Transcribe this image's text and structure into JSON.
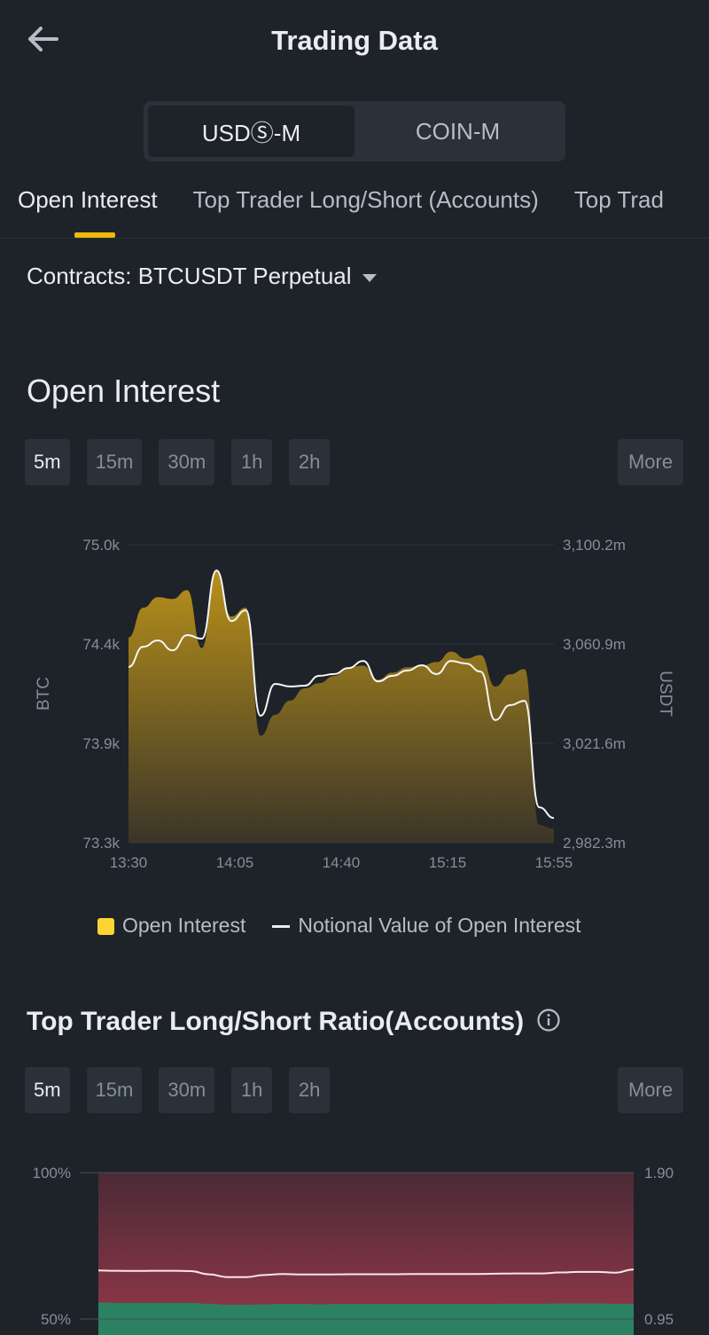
{
  "header": {
    "title": "Trading Data",
    "back_icon": "arrow-left-icon"
  },
  "segment": {
    "options": [
      "USDⓈ-M",
      "COIN-M"
    ],
    "selected": "USDⓈ-M"
  },
  "tabs": [
    "Open Interest",
    "Top Trader Long/Short (Accounts)",
    "Top Trad"
  ],
  "contract": {
    "label": "Contracts: BTCUSDT Perpetual"
  },
  "colors": {
    "accent": "#f0b90b",
    "background": "#1e2329",
    "long": "#2e8b67",
    "short": "#8f3545"
  },
  "section1": {
    "title": "Open Interest",
    "timeframes": [
      "5m",
      "15m",
      "30m",
      "1h",
      "2h"
    ],
    "selected": "5m",
    "more": "More"
  },
  "section2": {
    "title": "Top Trader Long/Short Ratio(Accounts)",
    "info_icon": "info-circle-icon",
    "timeframes": [
      "5m",
      "15m",
      "30m",
      "1h",
      "2h"
    ],
    "selected": "5m",
    "more": "More"
  },
  "chart_data": [
    {
      "type": "area",
      "ylabel": "BTC",
      "y2label": "USDT",
      "x_ticks": [
        "13:30",
        "14:05",
        "14:40",
        "15:15",
        "15:55"
      ],
      "y_ticks": [
        "75.0k",
        "74.4k",
        "73.9k",
        "73.3k"
      ],
      "y2_ticks": [
        "3,100.2m",
        "3,060.9m",
        "3,021.6m",
        "2,982.3m"
      ],
      "ylim": [
        73.3,
        75.0
      ],
      "y2lim": [
        2982.3,
        3100.2
      ],
      "interval_minutes": 5,
      "grid": "horizontal",
      "legend": {
        "placement": "bottom",
        "items": [
          "Open Interest",
          "Notional Value of Open Interest"
        ]
      },
      "series": [
        {
          "name": "Open Interest",
          "axis": "left",
          "type": "area",
          "color": "#f0b90b",
          "values": [
            74.47,
            74.64,
            74.7,
            74.69,
            74.74,
            74.41,
            74.85,
            74.59,
            74.64,
            73.91,
            74.03,
            74.11,
            74.18,
            74.21,
            74.25,
            74.3,
            74.31,
            74.23,
            74.27,
            74.3,
            74.31,
            74.33,
            74.39,
            74.35,
            74.37,
            74.19,
            74.26,
            74.29,
            73.4,
            73.38
          ]
        },
        {
          "name": "Notional Value of Open Interest",
          "axis": "right",
          "type": "line",
          "color": "#ffffff",
          "values": [
            3051.8,
            3059.8,
            3062.3,
            3058.4,
            3064.4,
            3063.0,
            3090.0,
            3070.0,
            3074.2,
            3032.5,
            3045.1,
            3044.1,
            3044.4,
            3048.3,
            3049.0,
            3051.4,
            3054.2,
            3046.1,
            3048.3,
            3050.4,
            3052.5,
            3049.0,
            3054.2,
            3053.2,
            3050.0,
            3030.8,
            3036.7,
            3038.4,
            2996.3,
            2992.1
          ]
        }
      ]
    },
    {
      "type": "area",
      "y_ticks": [
        "100%",
        "50%"
      ],
      "y2_ticks": [
        "1.90",
        "0.95"
      ],
      "ylim": [
        50,
        100
      ],
      "y2lim": [
        0.95,
        1.9
      ],
      "series": [
        {
          "axis": "left",
          "type": "stacked-area",
          "color": "#2e8b67",
          "values": [
            55.6,
            55.5,
            55.5,
            55.5,
            55.5,
            55.5,
            55.2,
            54.9,
            54.9,
            55.0,
            55.1,
            55.1,
            55.0,
            55.1,
            55.1,
            55.1,
            55.1,
            55.1,
            55.1,
            55.1,
            55.1,
            55.1,
            55.2,
            55.2,
            55.2,
            55.3,
            55.3,
            55.3,
            55.2,
            55.2
          ]
        },
        {
          "axis": "right",
          "type": "line",
          "color": "#ffffff",
          "values": [
            1.265,
            1.263,
            1.262,
            1.263,
            1.263,
            1.261,
            1.24,
            1.222,
            1.222,
            1.236,
            1.242,
            1.239,
            1.239,
            1.24,
            1.241,
            1.241,
            1.241,
            1.242,
            1.242,
            1.242,
            1.242,
            1.243,
            1.245,
            1.246,
            1.246,
            1.252,
            1.256,
            1.256,
            1.251,
            1.272
          ]
        }
      ]
    }
  ]
}
